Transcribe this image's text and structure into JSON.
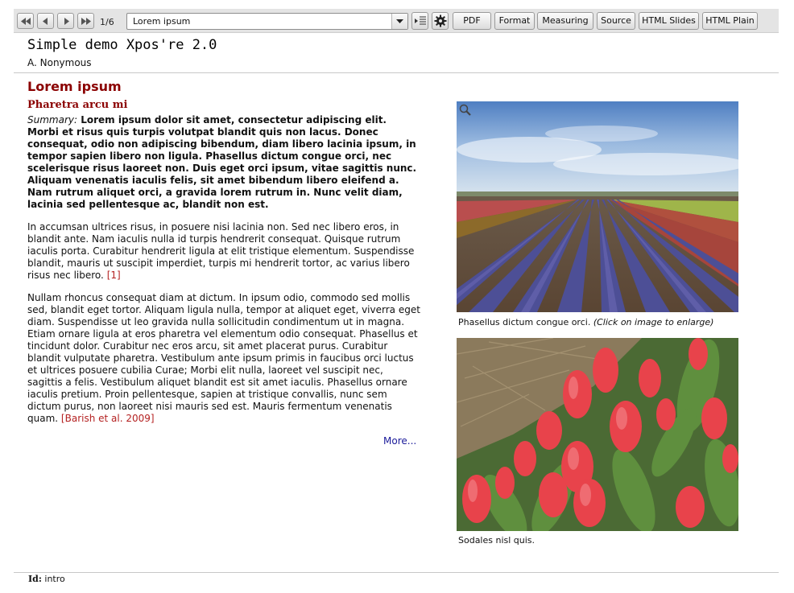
{
  "toolbar": {
    "page_indicator": "1/6",
    "section_select": {
      "value": "Lorem ipsum"
    },
    "buttons": {
      "pdf": "PDF",
      "format": "Format",
      "measuring": "Measuring",
      "source": "Source",
      "html_slides": "HTML Slides",
      "html_plain": "HTML Plain"
    },
    "icons": {
      "first": "first-page-icon",
      "prev": "previous-page-icon",
      "next": "next-page-icon",
      "last": "last-page-icon",
      "toc": "table-of-contents-icon",
      "settings": "gear-icon",
      "zoom": "magnifier-icon"
    }
  },
  "header": {
    "title": "Simple demo Xpos're 2.0",
    "author": "A. Nonymous"
  },
  "slide": {
    "title": "Lorem ipsum",
    "section_heading": "Pharetra arcu mi",
    "summary_label": "Summary:",
    "summary_text": "Lorem ipsum dolor sit amet, consectetur adipiscing elit. Morbi et risus quis turpis volutpat blandit quis non lacus. Donec consequat, odio non adipiscing bibendum, diam libero lacinia ipsum, in tempor sapien libero non ligula. Phasellus dictum congue orci, nec scelerisque risus laoreet non. Duis eget orci ipsum, vitae sagittis nunc. Aliquam venenatis iaculis felis, sit amet bibendum libero eleifend a. Nam rutrum aliquet orci, a gravida lorem rutrum in. Nunc velit diam, lacinia sed pellentesque ac, blandit non est.",
    "paragraph1": "In accumsan ultrices risus, in posuere nisi lacinia non. Sed nec libero eros, in blandit ante. Nam iaculis nulla id turpis hendrerit consequat. Quisque rutrum iaculis porta. Curabitur hendrerit ligula at elit tristique elementum. Suspendisse blandit, mauris ut suscipit imperdiet, turpis mi hendrerit tortor, ac varius libero risus nec libero.",
    "citation1": "[1]",
    "paragraph2": "Nullam rhoncus consequat diam at dictum. In ipsum odio, commodo sed mollis sed, blandit eget tortor. Aliquam ligula nulla, tempor at aliquet eget, viverra eget diam. Suspendisse ut leo gravida nulla sollicitudin condimentum ut in magna. Etiam ornare ligula at eros pharetra vel elementum odio consequat. Phasellus et tincidunt dolor. Curabitur nec eros arcu, sit amet placerat purus. Curabitur blandit vulputate pharetra. Vestibulum ante ipsum primis in faucibus orci luctus et ultrices posuere cubilia Curae; Morbi elit nulla, laoreet vel suscipit nec, sagittis a felis. Vestibulum aliquet blandit est sit amet iaculis. Phasellus ornare iaculis pretium. Proin pellentesque, sapien at tristique convallis, nunc sem dictum purus, non laoreet nisi mauris sed est. Mauris fermentum venenatis quam.",
    "citation2": "[Barish et al. 2009]",
    "more_link": "More..."
  },
  "figures": {
    "image1_caption": "Phasellus dictum congue orci.",
    "image1_hint": "(Click on image to enlarge)",
    "image2_caption": "Sodales nisl quis."
  },
  "footer": {
    "id_label": "Id:",
    "id_value": "intro"
  }
}
